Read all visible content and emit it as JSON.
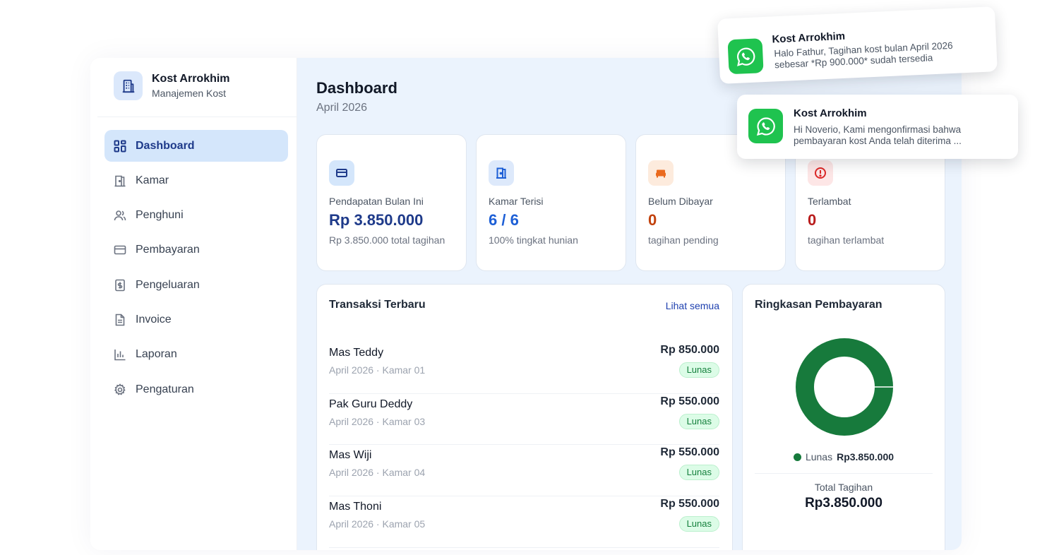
{
  "brand": {
    "name": "Kost Arrokhim",
    "subtitle": "Manajemen Kost",
    "icon": "building-icon"
  },
  "sidebar": {
    "items": [
      {
        "label": "Dashboard",
        "icon": "grid-icon",
        "active": true
      },
      {
        "label": "Kamar",
        "icon": "door-icon"
      },
      {
        "label": "Penghuni",
        "icon": "users-icon"
      },
      {
        "label": "Pembayaran",
        "icon": "credit-card-icon"
      },
      {
        "label": "Pengeluaran",
        "icon": "receipt-icon"
      },
      {
        "label": "Invoice",
        "icon": "document-icon"
      },
      {
        "label": "Laporan",
        "icon": "bar-chart-icon"
      },
      {
        "label": "Pengaturan",
        "icon": "gear-icon"
      }
    ]
  },
  "header": {
    "title": "Dashboard",
    "period": "April 2026"
  },
  "stats": [
    {
      "label": "Pendapatan Bulan Ini",
      "value": "Rp 3.850.000",
      "note": "Rp 3.850.000 total tagihan",
      "icon": "card-icon",
      "color": "#1e3a8a"
    },
    {
      "label": "Kamar Terisi",
      "value": "6 / 6",
      "note": "100% tingkat hunian",
      "icon": "door-icon",
      "color": "#1d5fd6"
    },
    {
      "label": "Belum Dibayar",
      "value": "0",
      "note": "tagihan pending",
      "icon": "sofa-icon",
      "color": "#c2410c"
    },
    {
      "label": "Terlambat",
      "value": "0",
      "note": "tagihan terlambat",
      "icon": "alert-icon",
      "color": "#b91c1c"
    }
  ],
  "transactions": {
    "title": "Transaksi Terbaru",
    "see_all": "Lihat semua",
    "rows": [
      {
        "name": "Mas Teddy",
        "meta": "April 2026 · Kamar 01",
        "amount": "Rp 850.000",
        "status": "Lunas"
      },
      {
        "name": "Pak Guru Deddy",
        "meta": "April 2026 · Kamar 03",
        "amount": "Rp 550.000",
        "status": "Lunas"
      },
      {
        "name": "Mas Wiji",
        "meta": "April 2026 · Kamar 04",
        "amount": "Rp 550.000",
        "status": "Lunas"
      },
      {
        "name": "Mas Thoni",
        "meta": "April 2026 · Kamar 05",
        "amount": "Rp 550.000",
        "status": "Lunas"
      }
    ]
  },
  "summary": {
    "title": "Ringkasan Pembayaran",
    "legend_label": "Lunas",
    "legend_value": "Rp3.850.000",
    "total_label": "Total Tagihan",
    "total_value": "Rp3.850.000",
    "color_paid": "#177a3c"
  },
  "chart_data": {
    "type": "pie",
    "categories": [
      "Lunas"
    ],
    "values": [
      3850000
    ],
    "colors": [
      "#177a3c"
    ]
  },
  "notifications": [
    {
      "title": "Kost Arrokhim",
      "line1": "Halo Fathur, Tagihan kost bulan April 2026",
      "line2": "sebesar *Rp 900.000* sudah tersedia",
      "icon": "whatsapp-icon"
    },
    {
      "title": "Kost Arrokhim",
      "line1": "Hi Noverio, Kami mengonfirmasi bahwa",
      "line2": "pembayaran kost Anda telah diterima ...",
      "icon": "whatsapp-icon"
    }
  ]
}
